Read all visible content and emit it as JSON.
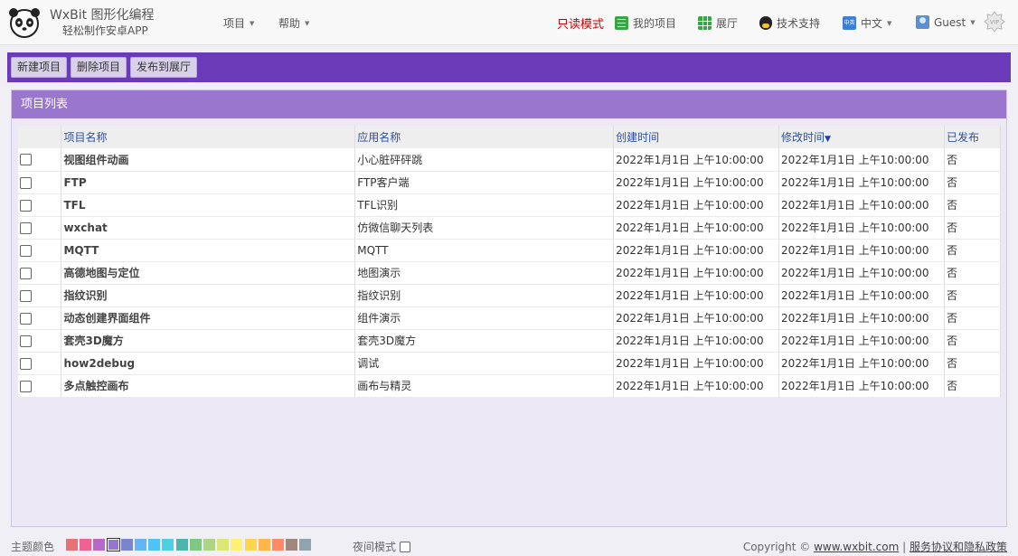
{
  "header": {
    "brand_title": "WxBit 图形化编程",
    "brand_sub": "轻松制作安卓APP",
    "nav_project": "项目",
    "nav_help": "帮助",
    "readonly": "只读模式",
    "my_projects": "我的项目",
    "gallery": "展厅",
    "support": "技术支持",
    "language": "中文",
    "lang_icon": "中英",
    "user": "Guest",
    "vip": "VIP"
  },
  "toolbar": {
    "new_label": "新建项目",
    "delete_label": "删除项目",
    "publish_label": "发布到展厅"
  },
  "panel": {
    "title": "项目列表"
  },
  "table": {
    "columns": [
      "项目名称",
      "应用名称",
      "创建时间",
      "修改时间",
      "已发布"
    ],
    "sort_indicator": "▼",
    "rows": [
      {
        "name": "视图组件动画",
        "app": "小心脏砰砰跳",
        "created": "2022年1月1日 上午10:00:00",
        "modified": "2022年1月1日 上午10:00:00",
        "published": "否"
      },
      {
        "name": "FTP",
        "app": "FTP客户端",
        "created": "2022年1月1日 上午10:00:00",
        "modified": "2022年1月1日 上午10:00:00",
        "published": "否"
      },
      {
        "name": "TFL",
        "app": "TFL识别",
        "created": "2022年1月1日 上午10:00:00",
        "modified": "2022年1月1日 上午10:00:00",
        "published": "否"
      },
      {
        "name": "wxchat",
        "app": "仿微信聊天列表",
        "created": "2022年1月1日 上午10:00:00",
        "modified": "2022年1月1日 上午10:00:00",
        "published": "否"
      },
      {
        "name": "MQTT",
        "app": "MQTT",
        "created": "2022年1月1日 上午10:00:00",
        "modified": "2022年1月1日 上午10:00:00",
        "published": "否"
      },
      {
        "name": "高德地图与定位",
        "app": "地图演示",
        "created": "2022年1月1日 上午10:00:00",
        "modified": "2022年1月1日 上午10:00:00",
        "published": "否"
      },
      {
        "name": "指纹识别",
        "app": "指纹识别",
        "created": "2022年1月1日 上午10:00:00",
        "modified": "2022年1月1日 上午10:00:00",
        "published": "否"
      },
      {
        "name": "动态创建界面组件",
        "app": "组件演示",
        "created": "2022年1月1日 上午10:00:00",
        "modified": "2022年1月1日 上午10:00:00",
        "published": "否"
      },
      {
        "name": "套壳3D魔方",
        "app": "套壳3D魔方",
        "created": "2022年1月1日 上午10:00:00",
        "modified": "2022年1月1日 上午10:00:00",
        "published": "否"
      },
      {
        "name": "how2debug",
        "app": "调试",
        "created": "2022年1月1日 上午10:00:00",
        "modified": "2022年1月1日 上午10:00:00",
        "published": "否"
      },
      {
        "name": "多点触控画布",
        "app": "画布与精灵",
        "created": "2022年1月1日 上午10:00:00",
        "modified": "2022年1月1日 上午10:00:00",
        "published": "否"
      }
    ]
  },
  "footer": {
    "theme_label": "主题颜色",
    "theme_colors": [
      "#e57373",
      "#f06292",
      "#ba68c8",
      "#9575cd",
      "#7986cb",
      "#64b5f6",
      "#4fc3f7",
      "#4dd0e1",
      "#4db6ac",
      "#81c784",
      "#aed581",
      "#dce775",
      "#fff176",
      "#ffd54f",
      "#ffb74d",
      "#ff8a65",
      "#a1887f",
      "#90a4ae"
    ],
    "selected_theme_index": 3,
    "night_mode": "夜间模式",
    "copyright_prefix": "Copyright ©",
    "site_link": "www.wxbit.com",
    "separator": "|",
    "terms_link": "服务协议和隐私政策"
  }
}
